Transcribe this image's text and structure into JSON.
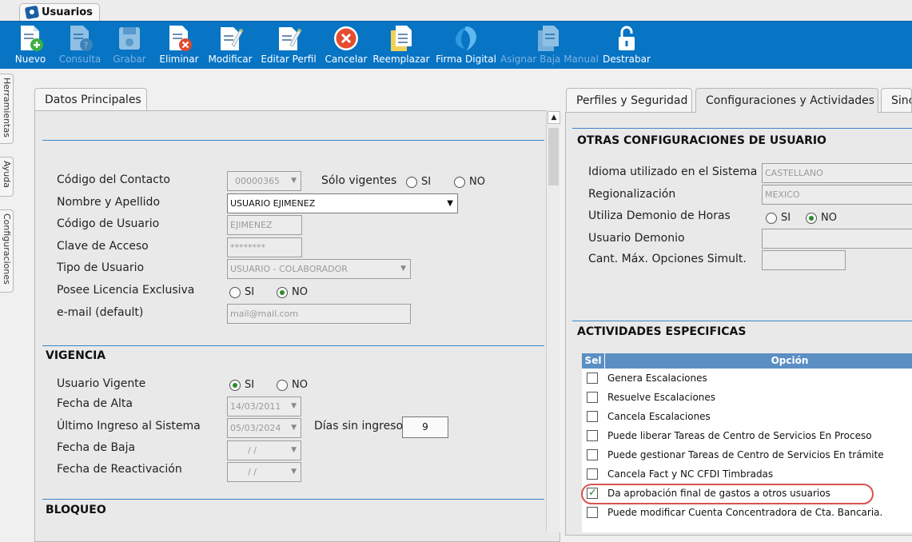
{
  "window_tab": {
    "label": "Usuarios"
  },
  "toolbar": [
    {
      "label": "Nuevo",
      "icon": "new-doc-icon",
      "enabled": true
    },
    {
      "label": "Consulta",
      "icon": "query-doc-icon",
      "enabled": false
    },
    {
      "label": "Grabar",
      "icon": "save-disk-icon",
      "enabled": false
    },
    {
      "label": "Eliminar",
      "icon": "delete-doc-icon",
      "enabled": true
    },
    {
      "label": "Modificar",
      "icon": "edit-doc-icon",
      "enabled": true
    },
    {
      "label": "Editar Perfil",
      "icon": "edit-profile-icon",
      "enabled": true
    },
    {
      "label": "Cancelar",
      "icon": "cancel-icon",
      "enabled": true
    },
    {
      "label": "Reemplazar",
      "icon": "replace-doc-icon",
      "enabled": true
    },
    {
      "label": "Firma Digital",
      "icon": "digital-signature-icon",
      "enabled": true
    },
    {
      "label": "Asignar Baja Manual",
      "icon": "assign-doc-icon",
      "enabled": false
    },
    {
      "label": "Destrabar",
      "icon": "unlock-icon",
      "enabled": true
    }
  ],
  "side_tabs": [
    "Herramientas",
    "Ayuda",
    "Configuraciones"
  ],
  "left": {
    "tab": "Datos Principales",
    "fields": {
      "codigo_contacto": {
        "label": "Código del Contacto",
        "value": "00000365"
      },
      "solo_vigentes": {
        "label": "Sólo vigentes",
        "si": "SI",
        "no": "NO"
      },
      "nombre": {
        "label": "Nombre y Apellido",
        "value": "USUARIO EJIMENEZ"
      },
      "codigo_usuario": {
        "label": "Código de Usuario",
        "value": "EJIMENEZ"
      },
      "clave": {
        "label": "Clave de Acceso",
        "value": "********"
      },
      "tipo_usuario": {
        "label": "Tipo de Usuario",
        "value": "USUARIO - COLABORADOR"
      },
      "licencia": {
        "label": "Posee Licencia Exclusiva",
        "si": "SI",
        "no": "NO"
      },
      "email": {
        "label": "e-mail (default)",
        "placeholder": "mail@mail.com"
      }
    },
    "vigencia": {
      "title": "VIGENCIA",
      "usuario_vigente": {
        "label": "Usuario Vigente",
        "si": "SI",
        "no": "NO"
      },
      "fecha_alta": {
        "label": "Fecha de Alta",
        "value": "14/03/2011"
      },
      "ultimo_ingreso": {
        "label": "Último Ingreso al Sistema",
        "value": "05/03/2024"
      },
      "dias_sin_ingreso": {
        "label": "Días sin ingreso",
        "value": "9"
      },
      "fecha_baja": {
        "label": "Fecha de Baja",
        "value": "/ /"
      },
      "fecha_reactivacion": {
        "label": "Fecha de Reactivación",
        "value": "/ /"
      }
    },
    "bloqueo": {
      "title": "BLOQUEO"
    }
  },
  "right": {
    "tabs": [
      "Perfiles y Seguridad",
      "Configuraciones y Actividades",
      "Sinc"
    ],
    "otras": {
      "title": "OTRAS CONFIGURACIONES DE USUARIO",
      "idioma": {
        "label": "Idioma utilizado en el Sistema",
        "value": "CASTELLANO"
      },
      "regionalizacion": {
        "label": "Regionalización",
        "value": "MEXICO"
      },
      "demonio_horas": {
        "label": "Utiliza Demonio de Horas",
        "si": "SI",
        "no": "NO"
      },
      "usuario_demonio": {
        "label": "Usuario Demonio",
        "value": ""
      },
      "cant_max": {
        "label": "Cant. Máx. Opciones Simult.",
        "value": ""
      }
    },
    "actividades": {
      "title": "ACTIVIDADES ESPECIFICAS",
      "col_sel": "Sel",
      "col_opcion": "Opción",
      "rows": [
        {
          "label": "Genera Escalaciones",
          "checked": false
        },
        {
          "label": "Resuelve Escalaciones",
          "checked": false
        },
        {
          "label": "Cancela Escalaciones",
          "checked": false
        },
        {
          "label": "Puede liberar Tareas de Centro de Servicios En Proceso",
          "checked": false
        },
        {
          "label": "Puede gestionar Tareas de Centro de Servicios En trámite",
          "checked": false
        },
        {
          "label": "Cancela Fact y NC CFDI Timbradas",
          "checked": false
        },
        {
          "label": "Da aprobación final de gastos a otros usuarios",
          "checked": true
        },
        {
          "label": "Puede modificar Cuenta Concentradora de Cta. Bancaria.",
          "checked": false
        }
      ]
    }
  }
}
